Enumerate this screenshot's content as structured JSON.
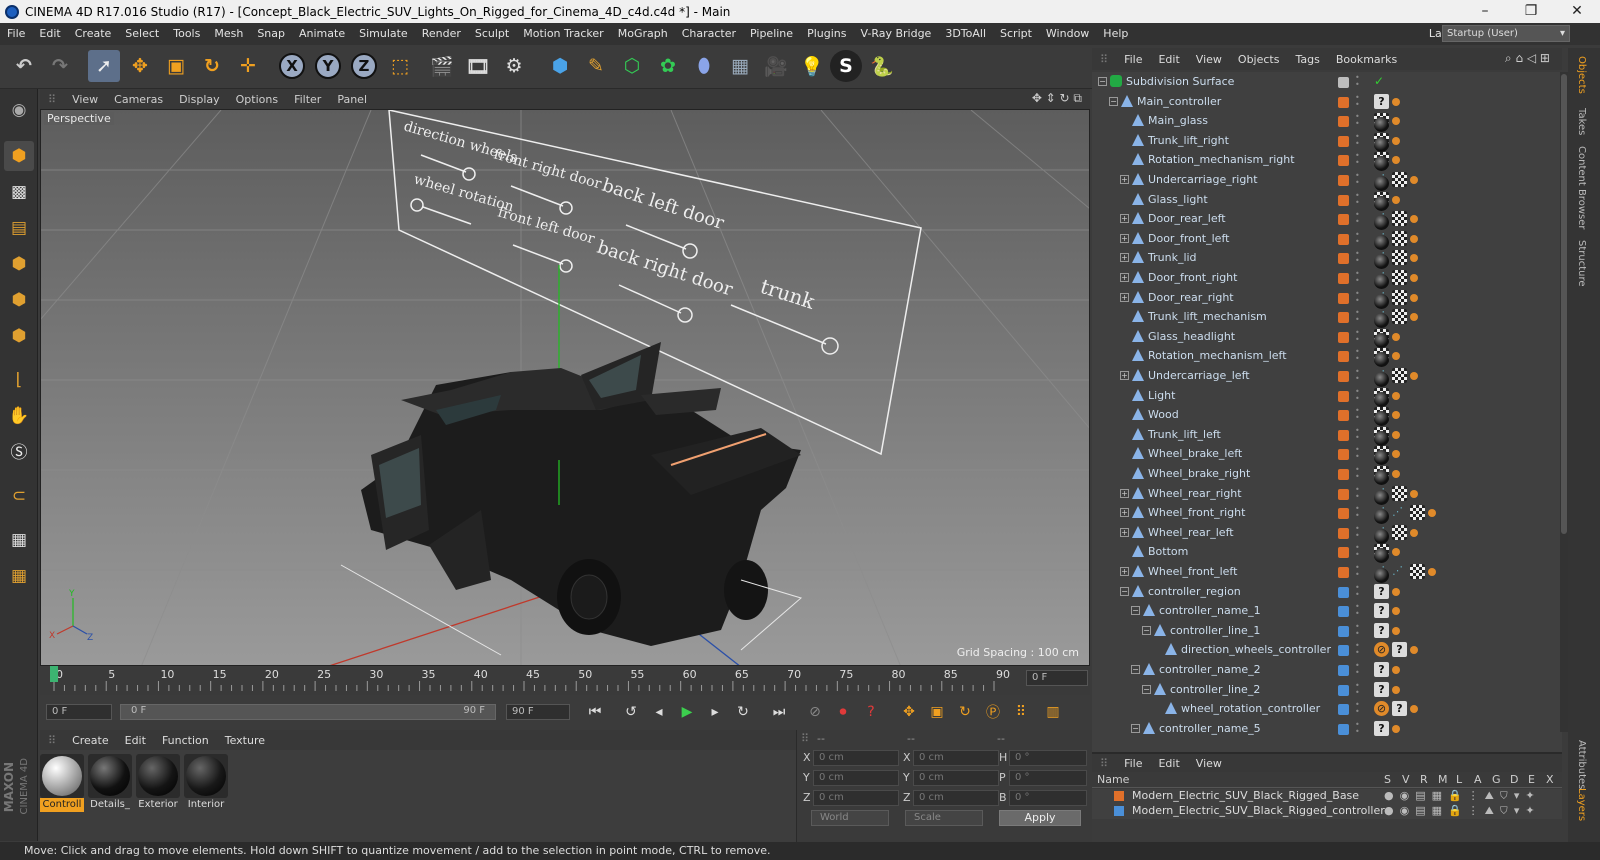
{
  "window": {
    "title": "CINEMA 4D R17.016 Studio (R17) - [Concept_Black_Electric_SUV_Lights_On_Rigged_for_Cinema_4D_c4d.c4d *] - Main",
    "minimize": "–",
    "restore": "❐",
    "close": "✕"
  },
  "menubar": {
    "items": [
      "File",
      "Edit",
      "Create",
      "Select",
      "Tools",
      "Mesh",
      "Snap",
      "Animate",
      "Simulate",
      "Render",
      "Sculpt",
      "Motion Tracker",
      "MoGraph",
      "Character",
      "Pipeline",
      "Plugins",
      "V-Ray Bridge",
      "3DToAll",
      "Script",
      "Window",
      "Help"
    ],
    "layout_label": "Layout:",
    "layout_value": "Startup (User)"
  },
  "toolbar": {
    "x": "X",
    "y": "Y",
    "z": "Z"
  },
  "viewport": {
    "menu": [
      "View",
      "Cameras",
      "Display",
      "Options",
      "Filter",
      "Panel"
    ],
    "label": "Perspective",
    "grid_spacing": "Grid Spacing : 100 cm",
    "controller_labels": [
      "direction wheels",
      "wheel rotation",
      "front right door",
      "front left door",
      "back left door",
      "back right door",
      "trunk"
    ]
  },
  "timeline": {
    "ticks": [
      "0",
      "5",
      "10",
      "15",
      "20",
      "25",
      "30",
      "35",
      "40",
      "45",
      "50",
      "55",
      "60",
      "65",
      "70",
      "75",
      "80",
      "85",
      "90"
    ],
    "frame_display": "0 F"
  },
  "transport": {
    "start_field": "0 F",
    "range_start": "0 F",
    "range_end": "90 F",
    "end_field": "90 F"
  },
  "material_manager": {
    "menu": [
      "Create",
      "Edit",
      "Function",
      "Texture"
    ],
    "materials": [
      {
        "name": "Controll",
        "selected": true
      },
      {
        "name": "Details_",
        "selected": false
      },
      {
        "name": "Exterior",
        "selected": false
      },
      {
        "name": "Interior",
        "selected": false
      }
    ]
  },
  "coordinates": {
    "header": [
      "--",
      "--",
      "--"
    ],
    "rows": [
      {
        "a": "X",
        "av": "0 cm",
        "b": "X",
        "bv": "0 cm",
        "c": "H",
        "cv": "0 °"
      },
      {
        "a": "Y",
        "av": "0 cm",
        "b": "Y",
        "bv": "0 cm",
        "c": "P",
        "cv": "0 °"
      },
      {
        "a": "Z",
        "av": "0 cm",
        "b": "Z",
        "bv": "0 cm",
        "c": "B",
        "cv": "0 °"
      }
    ],
    "mode": "World",
    "scale": "Scale",
    "apply": "Apply"
  },
  "object_manager": {
    "menu": [
      "File",
      "Edit",
      "View",
      "Objects",
      "Tags",
      "Bookmarks"
    ],
    "objects": [
      {
        "name": "Subdivision Surface",
        "level": 0,
        "exp": "-",
        "layer": "",
        "tags": []
      },
      {
        "name": "Main_controller",
        "level": 1,
        "exp": "-",
        "layer": "#e0702a",
        "tags": [
          "ph",
          "ora"
        ]
      },
      {
        "name": "Main_glass",
        "level": 2,
        "exp": "",
        "layer": "#e0702a",
        "tags": [
          "mat",
          "chk",
          "ora"
        ]
      },
      {
        "name": "Trunk_lift_right",
        "level": 2,
        "exp": "",
        "layer": "#e0702a",
        "tags": [
          "mat",
          "chk",
          "ora"
        ]
      },
      {
        "name": "Rotation_mechanism_right",
        "level": 2,
        "exp": "",
        "layer": "#e0702a",
        "tags": [
          "mat",
          "chk",
          "ora"
        ]
      },
      {
        "name": "Undercarriage_right",
        "level": 2,
        "exp": "+",
        "layer": "#e0702a",
        "tags": [
          "dot3",
          "mat",
          "chk",
          "ora"
        ]
      },
      {
        "name": "Glass_light",
        "level": 2,
        "exp": "",
        "layer": "#e0702a",
        "tags": [
          "mat",
          "chk",
          "ora"
        ]
      },
      {
        "name": "Door_rear_left",
        "level": 2,
        "exp": "+",
        "layer": "#e0702a",
        "tags": [
          "dot3",
          "mat",
          "chk",
          "ora"
        ]
      },
      {
        "name": "Door_front_left",
        "level": 2,
        "exp": "+",
        "layer": "#e0702a",
        "tags": [
          "dot3",
          "mat",
          "chk",
          "ora"
        ]
      },
      {
        "name": "Trunk_lid",
        "level": 2,
        "exp": "+",
        "layer": "#e0702a",
        "tags": [
          "dot3",
          "mat",
          "chk",
          "ora"
        ]
      },
      {
        "name": "Door_front_right",
        "level": 2,
        "exp": "+",
        "layer": "#e0702a",
        "tags": [
          "dot3",
          "mat",
          "chk",
          "ora"
        ]
      },
      {
        "name": "Door_rear_right",
        "level": 2,
        "exp": "+",
        "layer": "#e0702a",
        "tags": [
          "dot3",
          "mat",
          "chk",
          "ora"
        ]
      },
      {
        "name": "Trunk_lift_mechanism",
        "level": 2,
        "exp": "",
        "layer": "#e0702a",
        "tags": [
          "dot3",
          "mat",
          "chk",
          "ora"
        ]
      },
      {
        "name": "Glass_headlight",
        "level": 2,
        "exp": "",
        "layer": "#e0702a",
        "tags": [
          "mat",
          "chk",
          "ora"
        ]
      },
      {
        "name": "Rotation_mechanism_left",
        "level": 2,
        "exp": "",
        "layer": "#e0702a",
        "tags": [
          "mat",
          "chk",
          "ora"
        ]
      },
      {
        "name": "Undercarriage_left",
        "level": 2,
        "exp": "+",
        "layer": "#e0702a",
        "tags": [
          "dot3",
          "mat",
          "chk",
          "ora"
        ]
      },
      {
        "name": "Light",
        "level": 2,
        "exp": "",
        "layer": "#e0702a",
        "tags": [
          "mat",
          "chk",
          "ora"
        ]
      },
      {
        "name": "Wood",
        "level": 2,
        "exp": "",
        "layer": "#e0702a",
        "tags": [
          "mat",
          "chk",
          "ora"
        ]
      },
      {
        "name": "Trunk_lift_left",
        "level": 2,
        "exp": "",
        "layer": "#e0702a",
        "tags": [
          "mat",
          "chk",
          "ora"
        ]
      },
      {
        "name": "Wheel_brake_left",
        "level": 2,
        "exp": "",
        "layer": "#e0702a",
        "tags": [
          "mat",
          "chk",
          "ora"
        ]
      },
      {
        "name": "Wheel_brake_right",
        "level": 2,
        "exp": "",
        "layer": "#e0702a",
        "tags": [
          "mat",
          "chk",
          "ora"
        ]
      },
      {
        "name": "Wheel_rear_right",
        "level": 2,
        "exp": "+",
        "layer": "#e0702a",
        "tags": [
          "dot3",
          "mat",
          "chk",
          "ora"
        ]
      },
      {
        "name": "Wheel_front_right",
        "level": 2,
        "exp": "+",
        "layer": "#e0702a",
        "tags": [
          "dot3",
          "dot3",
          "mat",
          "chk",
          "ora"
        ]
      },
      {
        "name": "Wheel_rear_left",
        "level": 2,
        "exp": "+",
        "layer": "#e0702a",
        "tags": [
          "dot3",
          "mat",
          "chk",
          "ora"
        ]
      },
      {
        "name": "Bottom",
        "level": 2,
        "exp": "",
        "layer": "#e0702a",
        "tags": [
          "mat",
          "chk",
          "ora"
        ]
      },
      {
        "name": "Wheel_front_left",
        "level": 2,
        "exp": "+",
        "layer": "#e0702a",
        "tags": [
          "dot3",
          "dot3",
          "mat",
          "chk",
          "ora"
        ]
      },
      {
        "name": "controller_region",
        "level": 2,
        "exp": "-",
        "layer": "#4a8fd8",
        "tags": [
          "ph",
          "ora"
        ]
      },
      {
        "name": "controller_name_1",
        "level": 3,
        "exp": "-",
        "layer": "#4a8fd8",
        "tags": [
          "ph",
          "ora"
        ]
      },
      {
        "name": "controller_line_1",
        "level": 4,
        "exp": "-",
        "layer": "#4a8fd8",
        "tags": [
          "ph",
          "ora"
        ]
      },
      {
        "name": "direction_wheels_controller",
        "level": 5,
        "exp": "",
        "layer": "#4a8fd8",
        "tags": [
          "no",
          "ph",
          "ora"
        ]
      },
      {
        "name": "controller_name_2",
        "level": 3,
        "exp": "-",
        "layer": "#4a8fd8",
        "tags": [
          "ph",
          "ora"
        ]
      },
      {
        "name": "controller_line_2",
        "level": 4,
        "exp": "-",
        "layer": "#4a8fd8",
        "tags": [
          "ph",
          "ora"
        ]
      },
      {
        "name": "wheel_rotation_controller",
        "level": 5,
        "exp": "",
        "layer": "#4a8fd8",
        "tags": [
          "no",
          "ph",
          "ora"
        ]
      },
      {
        "name": "controller_name_5",
        "level": 3,
        "exp": "-",
        "layer": "#4a8fd8",
        "tags": [
          "ph",
          "ora"
        ]
      }
    ]
  },
  "layer_manager": {
    "menu": [
      "File",
      "Edit",
      "View"
    ],
    "header": {
      "name": "Name",
      "cols": [
        "S",
        "V",
        "R",
        "M",
        "L",
        "A",
        "G",
        "D",
        "E",
        "X"
      ]
    },
    "layers": [
      {
        "name": "Modern_Electric_SUV_Black_Rigged_Base",
        "color": "#e0702a"
      },
      {
        "name": "Modern_Electric_SUV_Black_Rigged_controllers",
        "color": "#4a8fd8"
      }
    ]
  },
  "right_tabs": [
    "Objects",
    "Takes",
    "Content Browser",
    "Structure",
    "Attributes",
    "Layers"
  ],
  "status": "Move: Click and drag to move elements. Hold down SHIFT to quantize movement / add to the selection in point mode, CTRL to remove.",
  "logo": {
    "line1": "MAXON",
    "line2": "CINEMA 4D"
  }
}
